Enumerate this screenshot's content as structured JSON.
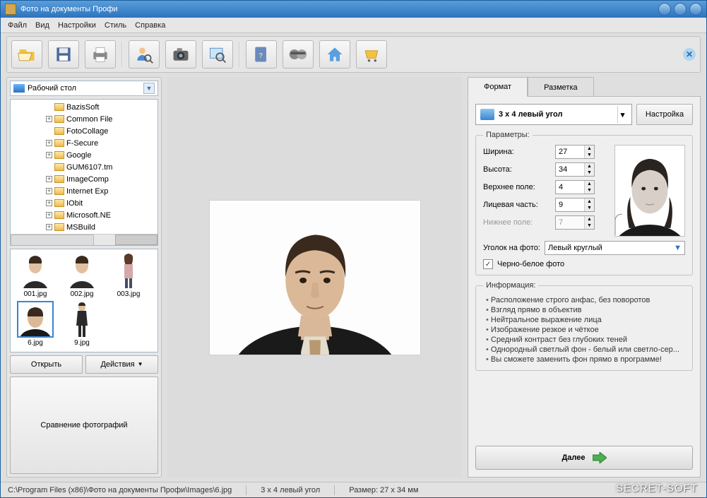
{
  "window": {
    "title": "Фото на документы Профи"
  },
  "menu": [
    "Файл",
    "Вид",
    "Настройки",
    "Стиль",
    "Справка"
  ],
  "toolbar_icons": [
    "open",
    "save",
    "print",
    "user-search",
    "camera",
    "zoom",
    "help",
    "video",
    "home",
    "cart"
  ],
  "sidebar": {
    "location_label": "Рабочий стол",
    "tree": [
      {
        "exp": "",
        "name": "BazisSoft"
      },
      {
        "exp": "+",
        "name": "Common File"
      },
      {
        "exp": "",
        "name": "FotoCollage"
      },
      {
        "exp": "+",
        "name": "F-Secure"
      },
      {
        "exp": "+",
        "name": "Google"
      },
      {
        "exp": "",
        "name": "GUM6107.tm"
      },
      {
        "exp": "+",
        "name": "ImageComp"
      },
      {
        "exp": "+",
        "name": "Internet Exp"
      },
      {
        "exp": "+",
        "name": "IObit"
      },
      {
        "exp": "+",
        "name": "Microsoft.NE"
      },
      {
        "exp": "+",
        "name": "MSBuild"
      }
    ],
    "thumbs": [
      "001.jpg",
      "002.jpg",
      "003.jpg",
      "6.jpg",
      "9.jpg"
    ],
    "selected_thumb": "6.jpg",
    "open_btn": "Открыть",
    "actions_btn": "Действия",
    "compare_btn": "Сравнение фотографий"
  },
  "tabs": {
    "format": "Формат",
    "layout": "Разметка"
  },
  "format": {
    "selector": "3 x 4 левый угол",
    "settings_btn": "Настройка",
    "params_legend": "Параметры:",
    "width_label": "Ширина:",
    "width": "27",
    "height_label": "Высота:",
    "height": "34",
    "topmargin_label": "Верхнее поле:",
    "topmargin": "4",
    "face_label": "Лицевая часть:",
    "face": "9",
    "bottom_label": "Нижнее поле:",
    "bottom": "7",
    "corner_label": "Уголок на фото:",
    "corner_value": "Левый круглый",
    "bw_label": "Черно-белое фото",
    "bw_checked": true
  },
  "info": {
    "legend": "Информация:",
    "items": [
      "Расположение строго анфас, без поворотов",
      "Взгляд прямо в объектив",
      "Нейтральное выражение лица",
      "Изображение резкое и чёткое",
      "Средний контраст без глубоких теней",
      "Однородный светлый фон - белый или светло-сер...",
      "Вы сможете заменить фон прямо в программе!"
    ]
  },
  "next_btn": "Далее",
  "status": {
    "path": "C:\\Program Files (x86)\\Фото на документы Профи\\Images\\6.jpg",
    "format": "3 x 4 левый угол",
    "size": "Размер: 27 x 34 мм"
  },
  "watermark": "SECRET-SOFT"
}
